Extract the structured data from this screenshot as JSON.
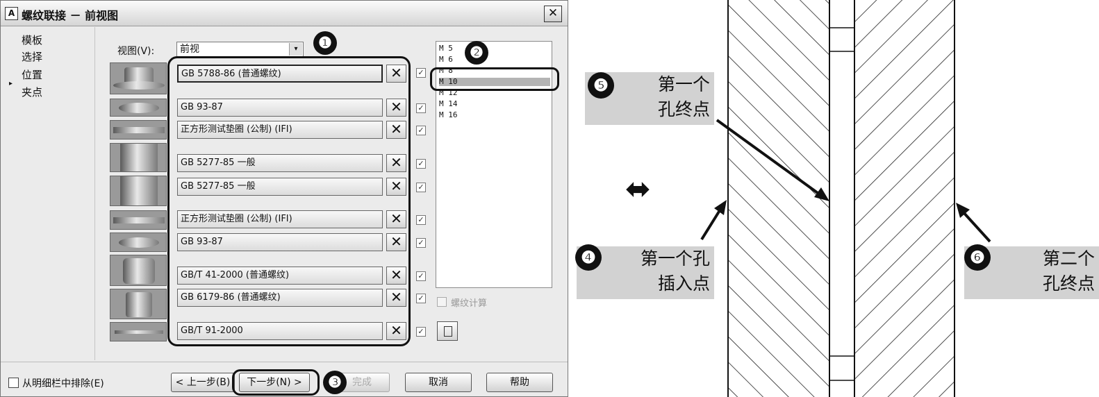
{
  "dialog": {
    "title": "螺纹联接 － 前视图",
    "app_icon": "A",
    "close_glyph": "✕",
    "nav": {
      "items": [
        "模板",
        "选择",
        "位置",
        "夹点"
      ],
      "current_marker": "▸"
    },
    "view": {
      "label": "视图(V):",
      "value": "前视",
      "arrow": "▾"
    },
    "parts": [
      {
        "name": "GB 5788-86  (普通螺纹)",
        "checked": true
      },
      {
        "name": "GB 93-87",
        "checked": true
      },
      {
        "name": "正方形测试垫圈 (公制) (IFI)",
        "checked": true
      },
      {
        "name": "GB 5277-85 一般",
        "checked": true
      },
      {
        "name": "GB 5277-85 一般",
        "checked": true
      },
      {
        "name": "正方形测试垫圈 (公制) (IFI)",
        "checked": true
      },
      {
        "name": "GB 93-87",
        "checked": true
      },
      {
        "name": "GB/T 41-2000  (普通螺纹)",
        "checked": true
      },
      {
        "name": "GB 6179-86  (普通螺纹)",
        "checked": true
      },
      {
        "name": "GB/T 91-2000",
        "checked": true
      }
    ],
    "delete_glyph": "✕",
    "check_glyph": "✓",
    "sizes": [
      "M 5",
      "M 6",
      "M 8",
      "M 10",
      "M 12",
      "M 14",
      "M 16"
    ],
    "selected_size": "M 10",
    "thread_calc": {
      "label": "螺纹计算",
      "checked": false,
      "enabled": false
    },
    "exclude": {
      "label": "从明细栏中排除(E)",
      "checked": false
    },
    "buttons": {
      "back": "< 上一步(B)",
      "next": "下一步(N) >",
      "finish": "完成",
      "cancel": "取消",
      "help": "帮助"
    },
    "callouts": [
      "❶",
      "❷",
      "❸"
    ]
  },
  "drawing": {
    "arrow_glyph": "⬌",
    "labels": [
      {
        "num": "❺",
        "lines": [
          "第一个",
          "孔终点"
        ]
      },
      {
        "num": "❹",
        "lines": [
          "第一个孔",
          "插入点"
        ]
      },
      {
        "num": "❻",
        "lines": [
          "第二个",
          "孔终点"
        ]
      }
    ]
  }
}
